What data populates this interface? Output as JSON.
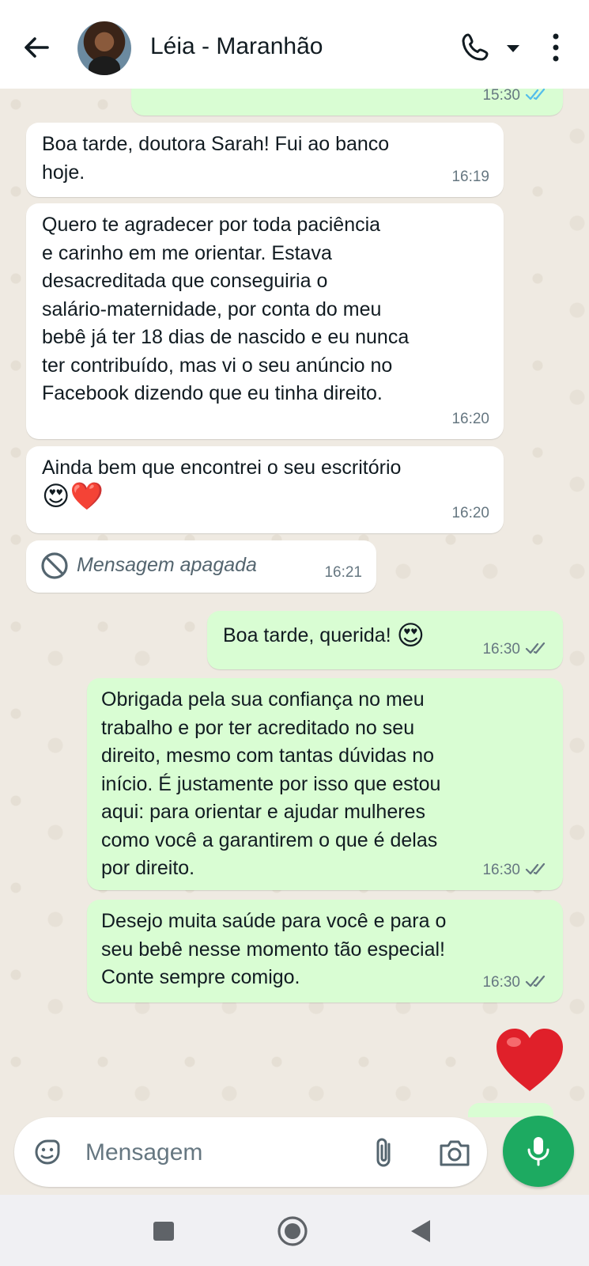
{
  "header": {
    "contact_name": "Léia - Maranhão"
  },
  "messages": [
    {
      "dir": "out",
      "time": "15:30",
      "text": "",
      "partial": true
    },
    {
      "dir": "in",
      "time": "16:19",
      "text": "Boa tarde, doutora Sarah! Fui ao banco\nhoje."
    },
    {
      "dir": "in",
      "time": "16:20",
      "text": "Quero te agradecer por toda paciência\ne carinho em me orientar. Estava\ndesacreditada que conseguiria o\nsalário-maternidade, por conta do meu\nbebê já ter 18 dias de nascido e eu nunca\nter contribuído, mas vi o seu anúncio no\nFacebook dizendo que eu tinha direito."
    },
    {
      "dir": "in",
      "time": "16:20",
      "text": "Ainda bem que encontrei o seu escritório",
      "emoji": "😍❤️"
    },
    {
      "dir": "in",
      "time": "16:21",
      "text": "Mensagem apagada",
      "deleted": true
    },
    {
      "dir": "out",
      "time": "16:30",
      "text": "Boa tarde, querida!",
      "emoji": "😍"
    },
    {
      "dir": "out",
      "time": "16:30",
      "text": "Obrigada pela sua confiança no meu\ntrabalho e por ter acreditado no seu\ndireito, mesmo com tantas dúvidas no\ninício. É justamente por isso que estou\naqui: para orientar e ajudar mulheres\ncomo você a garantirem o que é delas\npor direito."
    },
    {
      "dir": "out",
      "time": "16:30",
      "text": "Desejo muita saúde para você e para o\nseu bebê nesse momento tão especial!\nConte sempre comigo."
    },
    {
      "dir": "out",
      "emoji": "❤️",
      "big": true
    }
  ],
  "input": {
    "placeholder": "Mensagem"
  },
  "colors": {
    "outgoing_bubble": "#d9fdd3",
    "incoming_bubble": "#ffffff",
    "chat_background": "#efeae2",
    "mic_button": "#1daa61",
    "read_ticks_blue": "#53bdeb"
  }
}
